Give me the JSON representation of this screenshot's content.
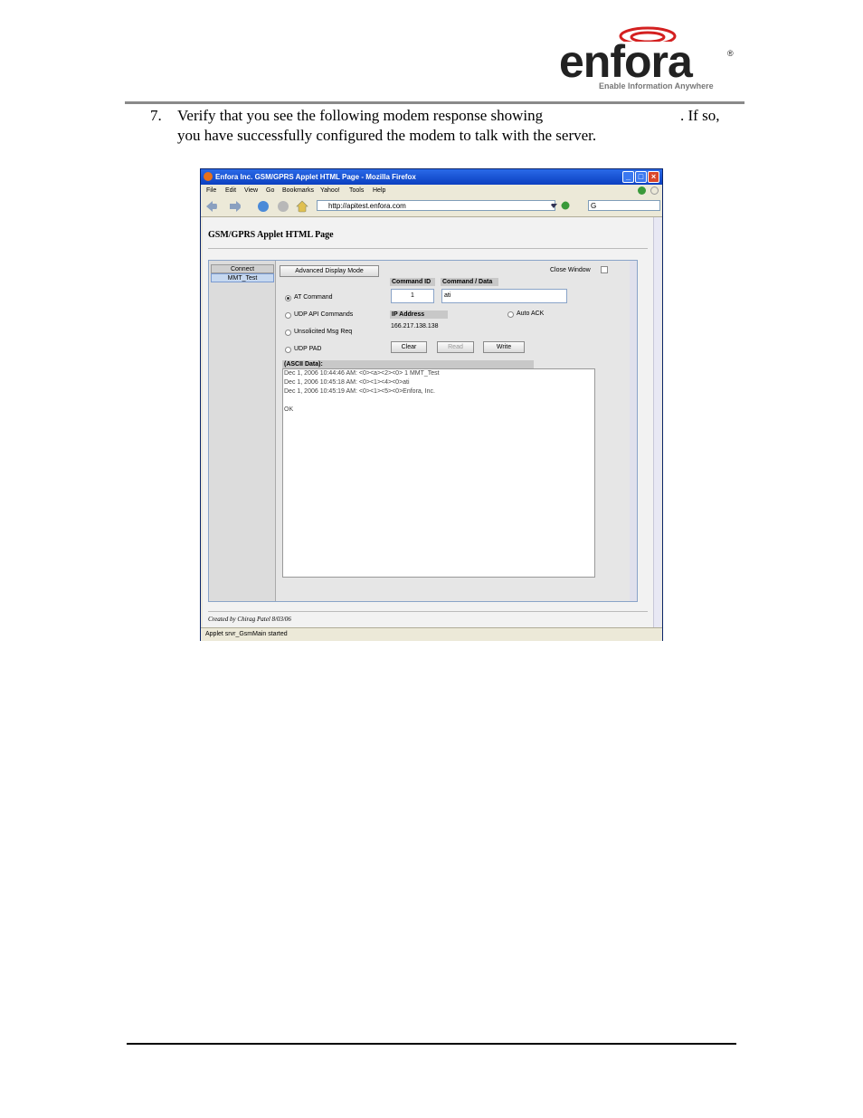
{
  "logo": {
    "brand": "enfora",
    "tagline": "Enable Information Anywhere"
  },
  "step": {
    "number": "7.",
    "line1_part1": "Verify that you see the following modem response showing",
    "line1_part2": ".  If so,",
    "line2": "you have successfully configured the modem to talk with the server."
  },
  "browser": {
    "title": "Enfora Inc. GSM/GPRS Applet HTML Page - Mozilla Firefox",
    "menu": [
      "File",
      "Edit",
      "View",
      "Go",
      "Bookmarks",
      "Yahoo!",
      "Tools",
      "Help"
    ],
    "url": "http://apitest.enfora.com",
    "search_value": "G",
    "status": "Applet srvr_GsmMain started"
  },
  "page": {
    "title": "GSM/GPRS Applet HTML Page",
    "created_by": "Created by Chirag Patel 8/03/06"
  },
  "applet": {
    "list_header": "Connect",
    "list_item": "MMT_Test",
    "advanced_button": "Advanced Display Mode",
    "close_window_label": "Close Window",
    "radios": [
      "AT Command",
      "UDP API Commands",
      "Unsolicited Msg Req",
      "UDP PAD"
    ],
    "command_id_label": "Command ID",
    "command_data_label": "Command / Data",
    "command_id_value": "1",
    "command_data_value": "ati",
    "ip_label": "IP Address",
    "ip_value": "166.217.138.138",
    "auto_ack_label": "Auto ACK",
    "clear_button": "Clear",
    "read_button": "Read",
    "write_button": "Write",
    "ascii_label": "(ASCII Data):",
    "console_lines": [
      "Dec 1, 2006 10:44:46 AM:  <0><a><2><0>      1           MMT_Test",
      "Dec 1, 2006 10:45:18 AM:  <0><1><4><0>ati",
      "Dec 1, 2006 10:45:19 AM:  <0><1><5><0>Enfora, Inc.",
      "",
      "OK"
    ]
  }
}
